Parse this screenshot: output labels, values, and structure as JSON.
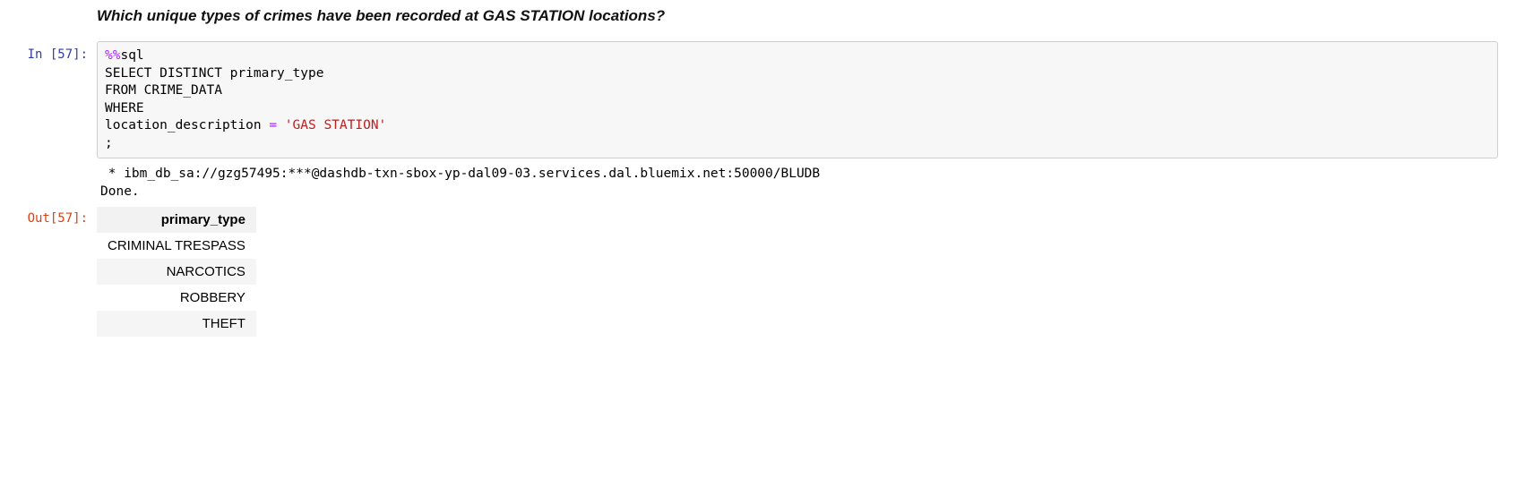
{
  "markdown": {
    "heading": "Which unique types of crimes have been recorded at GAS STATION locations?"
  },
  "prompts": {
    "in_label": "In [57]:",
    "out_label": "Out[57]:"
  },
  "code": {
    "magic": "%%",
    "magic_cmd": "sql",
    "line2_a": "SELECT DISTINCT primary_type",
    "line3_a": "FROM CRIME_DATA",
    "line4_a": "WHERE",
    "line5_a": "location_description ",
    "line5_op": "=",
    "line5_sp": " ",
    "line5_str": "'GAS STATION'",
    "line6_a": ";"
  },
  "stream": {
    "line1": " * ibm_db_sa://gzg57495:***@dashdb-txn-sbox-yp-dal09-03.services.dal.bluemix.net:50000/BLUDB",
    "line2": "Done."
  },
  "table": {
    "header": "primary_type",
    "rows": [
      "CRIMINAL TRESPASS",
      "NARCOTICS",
      "ROBBERY",
      "THEFT"
    ]
  }
}
